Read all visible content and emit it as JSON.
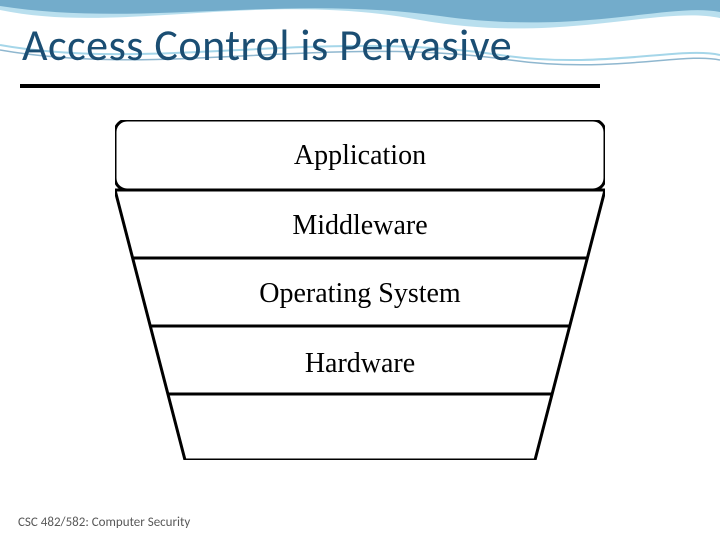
{
  "title": "Access Control is Pervasive",
  "layers": {
    "l0": "Application",
    "l1": "Middleware",
    "l2": "Operating System",
    "l3": "Hardware"
  },
  "footer": "CSC 482/582: Computer Security",
  "colors": {
    "title": "#1b4e73",
    "wave_dark": "#1f6fa0",
    "wave_light": "#7fc4e0"
  }
}
